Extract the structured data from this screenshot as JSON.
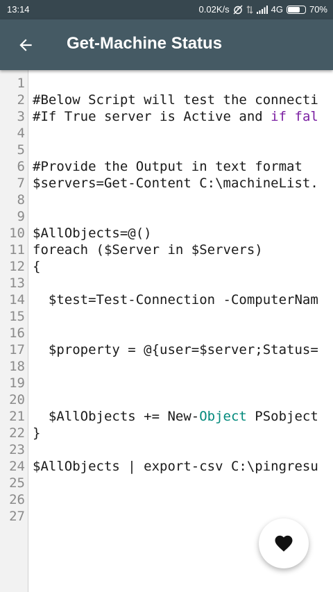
{
  "status_bar": {
    "time": "13:14",
    "network_speed": "0.02K/s",
    "network_type": "4G",
    "battery": "70%",
    "battery_level": 0.7,
    "icons": [
      "alarm-off-icon",
      "data-transfer-icon",
      "signal-icon",
      "battery-icon"
    ]
  },
  "app_bar": {
    "title": "Get-Machine Status",
    "back_icon": "back-arrow-icon"
  },
  "editor": {
    "lines": [
      {
        "num": "1",
        "segments": [
          {
            "t": ""
          }
        ]
      },
      {
        "num": "2",
        "segments": [
          {
            "t": "#Below Script will test the connecti"
          }
        ]
      },
      {
        "num": "3",
        "segments": [
          {
            "t": "#If True server is Active and "
          },
          {
            "t": "if",
            "c": "purple"
          },
          {
            "t": " "
          },
          {
            "t": "fal",
            "c": "purple"
          }
        ]
      },
      {
        "num": "4",
        "segments": [
          {
            "t": ""
          }
        ]
      },
      {
        "num": "5",
        "segments": [
          {
            "t": ""
          }
        ]
      },
      {
        "num": "6",
        "segments": [
          {
            "t": "#Provide the Output in text format"
          }
        ]
      },
      {
        "num": "7",
        "segments": [
          {
            "t": "$servers=Get-Content C:\\machineList."
          }
        ]
      },
      {
        "num": "8",
        "segments": [
          {
            "t": ""
          }
        ]
      },
      {
        "num": "9",
        "segments": [
          {
            "t": ""
          }
        ]
      },
      {
        "num": "10",
        "segments": [
          {
            "t": "$AllObjects=@()"
          }
        ]
      },
      {
        "num": "11",
        "segments": [
          {
            "t": "foreach ($Server in $Servers)"
          }
        ]
      },
      {
        "num": "12",
        "segments": [
          {
            "t": "{"
          }
        ]
      },
      {
        "num": "13",
        "segments": [
          {
            "t": ""
          }
        ]
      },
      {
        "num": "14",
        "segments": [
          {
            "t": "  $test=Test-Connection -ComputerNam"
          }
        ]
      },
      {
        "num": "15",
        "segments": [
          {
            "t": ""
          }
        ]
      },
      {
        "num": "16",
        "segments": [
          {
            "t": ""
          }
        ]
      },
      {
        "num": "17",
        "segments": [
          {
            "t": "  $property = @{user=$server;Status="
          }
        ]
      },
      {
        "num": "18",
        "segments": [
          {
            "t": ""
          }
        ]
      },
      {
        "num": "19",
        "segments": [
          {
            "t": ""
          }
        ]
      },
      {
        "num": "20",
        "segments": [
          {
            "t": ""
          }
        ]
      },
      {
        "num": "21",
        "segments": [
          {
            "t": "  $AllObjects += New-"
          },
          {
            "t": "Object",
            "c": "teal"
          },
          {
            "t": " PSobject"
          }
        ]
      },
      {
        "num": "22",
        "segments": [
          {
            "t": "}"
          }
        ]
      },
      {
        "num": "23",
        "segments": [
          {
            "t": ""
          }
        ]
      },
      {
        "num": "24",
        "segments": [
          {
            "t": "$AllObjects | export-csv C:\\pingresu"
          }
        ]
      },
      {
        "num": "25",
        "segments": [
          {
            "t": ""
          }
        ]
      },
      {
        "num": "26",
        "segments": [
          {
            "t": ""
          }
        ]
      },
      {
        "num": "27",
        "segments": [
          {
            "t": ""
          }
        ]
      }
    ]
  },
  "fab": {
    "icon": "heart-icon"
  },
  "colors": {
    "status_bar": "#37474f",
    "app_bar": "#455a64",
    "gutter": "#f2f2f2",
    "keyword_purple": "#7b1fa2",
    "keyword_teal": "#00897b"
  }
}
